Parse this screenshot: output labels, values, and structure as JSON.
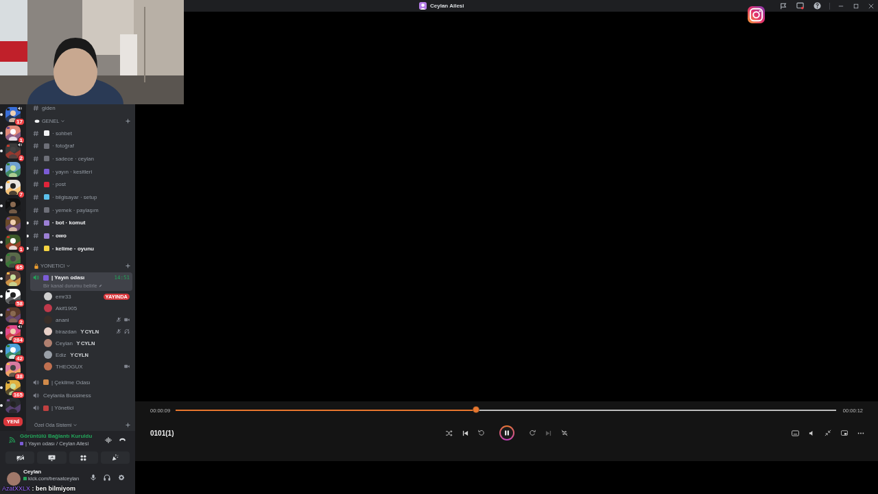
{
  "window": {
    "title": "Ceylan Ailesi"
  },
  "servers": [
    {
      "badge": "17",
      "unread": true,
      "voice": true
    },
    {
      "badge": "1",
      "unread": true,
      "voice": false
    },
    {
      "badge": "2",
      "unread": true,
      "voice": true
    },
    {
      "unread": true,
      "voice": false
    },
    {
      "badge": "7",
      "unread": true,
      "voice": false
    },
    {
      "unread": true,
      "voice": false
    },
    {
      "unread": false,
      "voice": false
    },
    {
      "badge": "1",
      "unread": true,
      "voice": false
    },
    {
      "badge": "65",
      "unread": true,
      "voice": false
    },
    {
      "unread": true,
      "voice": false
    },
    {
      "badge": "58",
      "unread": true,
      "voice": false
    },
    {
      "badge": "2",
      "unread": true,
      "voice": false
    },
    {
      "badge": "284",
      "unread": true,
      "voice": true
    },
    {
      "badge": "42",
      "unread": true,
      "voice": false
    },
    {
      "badge": "38",
      "unread": true,
      "voice": false
    },
    {
      "badge": "165",
      "unread": true,
      "voice": false
    },
    {
      "unread": true,
      "voice": false
    }
  ],
  "new_label": "YENİ",
  "channel_list": {
    "top_channels": [
      {
        "name": "giden",
        "unread": false
      }
    ],
    "categories": [
      {
        "name": "GENEL",
        "kind": "chat",
        "channels": [
          {
            "kind": "text",
            "name": "· sohbet",
            "unread": false,
            "color": "#f2f3f5"
          },
          {
            "kind": "text",
            "name": "· fotoğraf",
            "unread": false,
            "color": "#6d6f78"
          },
          {
            "kind": "text",
            "name": "· sadece · ceylan",
            "unread": false,
            "color": "#6d6f78"
          },
          {
            "kind": "text",
            "name": "· yayın · kesitleri",
            "unread": false,
            "color": "#7b5cd6"
          },
          {
            "kind": "text",
            "name": "· post",
            "unread": false,
            "color": "#e0243a"
          },
          {
            "kind": "text",
            "name": "· bilgisayar · setup",
            "unread": false,
            "color": "#5bc0eb"
          },
          {
            "kind": "text",
            "name": "· yemek · paylaşım",
            "unread": false,
            "color": "#6d6f78"
          },
          {
            "kind": "text",
            "name": "· bot · komut",
            "unread": true,
            "color": "#9b7fd4"
          },
          {
            "kind": "text",
            "name": "· owo",
            "unread": true,
            "color": "#9b7fd4"
          },
          {
            "kind": "text",
            "name": "· kelime · oyunu",
            "unread": true,
            "color": "#f5d442"
          }
        ]
      },
      {
        "name": "YONETICI",
        "kind": "locked",
        "channels": [
          {
            "kind": "voice",
            "name": "| Yayın odası",
            "selected": true,
            "time": "14:51",
            "status": "Bir kanal durumu belirle",
            "color": "#7b5cd6",
            "users": [
              {
                "name": "emr33",
                "color": "#cfcfcf",
                "badge": "YAYINDA",
                "muted": false,
                "deafened": false,
                "video": false
              },
              {
                "name": "Akif1905",
                "color": "#c0394b",
                "muted": false,
                "deafened": false,
                "video": false
              },
              {
                "name": "anani",
                "color": "#3a2e28",
                "muted": true,
                "deafened": false,
                "video": true
              },
              {
                "name": "birazdan",
                "tag": "CYLN",
                "color": "#e8d0c8",
                "muted": true,
                "deafened": true,
                "video": false
              },
              {
                "name": "Ceylan",
                "tag": "CYLN",
                "color": "#b08070",
                "muted": false,
                "deafened": false,
                "video": false
              },
              {
                "name": "Ediz",
                "tag": "CYLN",
                "color": "#9aa0a8",
                "muted": false,
                "deafened": false,
                "video": false
              },
              {
                "name": "THEOGUX",
                "color": "#c07050",
                "muted": false,
                "deafened": false,
                "video": true
              }
            ]
          },
          {
            "kind": "voice",
            "name": "| Çekilme Odası",
            "selected": false,
            "color": "#d08a4a"
          },
          {
            "kind": "voice",
            "name": "Ceylanla Bussiness",
            "selected": false
          },
          {
            "kind": "voice",
            "name": "| Yönetici",
            "selected": false,
            "color": "#c04040"
          }
        ]
      },
      {
        "name": "Özel Oda Sistemi",
        "kind": "plain"
      }
    ]
  },
  "voice_connection": {
    "status": "Görüntülü Bağlantı Kuruldu",
    "channel": "| Yayın odası / Ceylan Ailesi",
    "camera_on": false
  },
  "user": {
    "name": "Ceylan",
    "status": "kick.com/beraatceylan"
  },
  "chat_overlay": {
    "user": "AzatXXLX",
    "message": ": ben bilmiyom"
  },
  "player": {
    "elapsed": "00:00:09",
    "duration": "00:00:12",
    "level": 0.455,
    "title": "0101(1)",
    "playing": true,
    "next_disabled": true
  }
}
